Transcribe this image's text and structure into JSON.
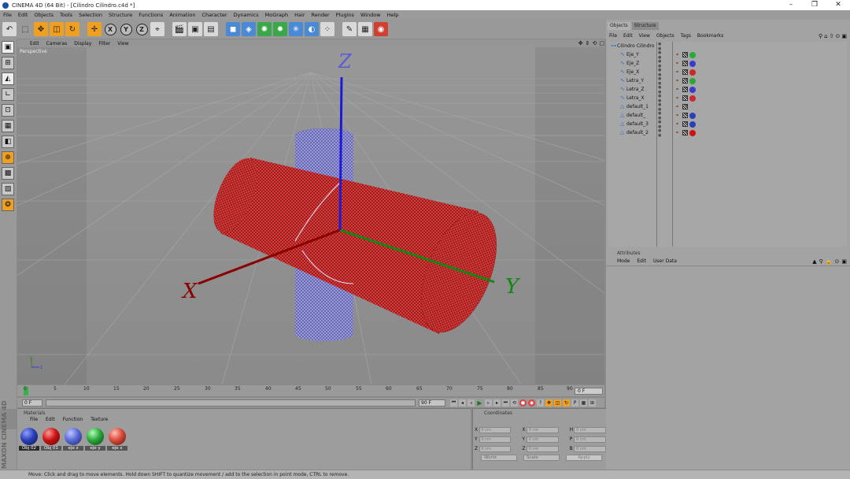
{
  "window": {
    "title": "CINEMA 4D (64 Bit) - [Cilindro Cilindro.c4d *]",
    "controls": [
      "–",
      "❐",
      "✕"
    ]
  },
  "menu": [
    "File",
    "Edit",
    "Objects",
    "Tools",
    "Selection",
    "Structure",
    "Functions",
    "Animation",
    "Character",
    "Dynamics",
    "MoGraph",
    "Hair",
    "Render",
    "Plugins",
    "Window",
    "Help"
  ],
  "toolbar": {
    "undo_icon": "↶",
    "axis_x": "X",
    "axis_y": "Y",
    "axis_z": "Z"
  },
  "viewport": {
    "menu": [
      "Edit",
      "Cameras",
      "Display",
      "Filter",
      "View"
    ],
    "label": "Perspective",
    "axis_labels": {
      "x": "X",
      "y": "Y",
      "z": "Z"
    },
    "corner_axes": {
      "y": "y",
      "z": "z"
    }
  },
  "timeline": {
    "ticks": [
      "0",
      "5",
      "10",
      "15",
      "20",
      "25",
      "30",
      "35",
      "40",
      "45",
      "50",
      "55",
      "60",
      "65",
      "70",
      "75",
      "80",
      "85",
      "90"
    ],
    "current_frame": "0 F",
    "start_frame": "0 F",
    "end_frame": "90 F"
  },
  "materials": {
    "panel_title": "Materials",
    "menu": [
      "File",
      "Edit",
      "Function",
      "Texture"
    ],
    "items": [
      {
        "name": "Obj 02",
        "color": "#2a3fb8"
      },
      {
        "name": "Obj 01",
        "color": "#cc1212"
      },
      {
        "name": "eje z",
        "color": "#5a6ad8"
      },
      {
        "name": "eje y",
        "color": "#2aa83a"
      },
      {
        "name": "eje x",
        "color": "#d84a3a"
      }
    ]
  },
  "coordinates": {
    "panel_title": "Coordinates",
    "rows": [
      {
        "a1": "X",
        "a2": "X",
        "a3": "H",
        "v": "0 cm"
      },
      {
        "a1": "Y",
        "a2": "Y",
        "a3": "P",
        "v": "0 cm"
      },
      {
        "a1": "Z",
        "a2": "Z",
        "a3": "B",
        "v": "0 cm"
      }
    ],
    "mode": "World",
    "scale": "Scale",
    "apply": "Apply"
  },
  "status": "Move: Click and drag to move elements. Hold down SHIFT to quantize movement / add to the selection in point mode, CTRL to remove.",
  "logo": "MAXON CINEMA 4D",
  "objects_panel": {
    "tabs": [
      "Objects",
      "Structure"
    ],
    "menu": [
      "File",
      "Edit",
      "View",
      "Objects",
      "Tags",
      "Bookmarks"
    ],
    "root": "Cilindro Cilindro",
    "items": [
      {
        "name": "Eje_Y",
        "color": "#2aa83a"
      },
      {
        "name": "Eje_Z",
        "color": "#3a3acc"
      },
      {
        "name": "Eje_X",
        "color": "#cc2a2a"
      },
      {
        "name": "Letra_Y",
        "color": "#2aa83a"
      },
      {
        "name": "Letra_Z",
        "color": "#3a3acc"
      },
      {
        "name": "Letra_X",
        "color": "#cc2a2a"
      },
      {
        "name": "default_1",
        "color": ""
      },
      {
        "name": "default_",
        "color": "#2a3fb8"
      },
      {
        "name": "default_3",
        "color": "#2a3fb8"
      },
      {
        "name": "default_2",
        "color": "#cc1212"
      }
    ]
  },
  "attributes_panel": {
    "title": "Attributes",
    "menu": [
      "Mode",
      "Edit",
      "User Data"
    ]
  }
}
